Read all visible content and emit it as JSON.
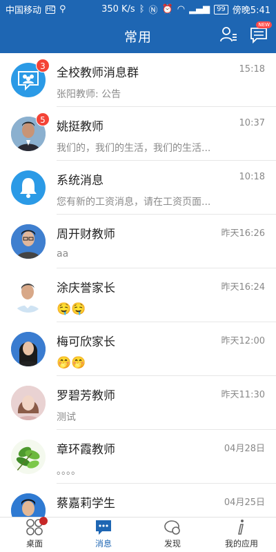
{
  "status_bar": {
    "carrier": "中国移动",
    "hd": "HD",
    "speed": "350 K/s",
    "battery": "99",
    "time": "傍晚5:41"
  },
  "header": {
    "title": "常用",
    "new_badge": "NEW"
  },
  "chats": [
    {
      "name": "全校教师消息群",
      "time": "15:18",
      "preview": "张阳教师: 公告",
      "badge": "3",
      "avatar": "group-icon"
    },
    {
      "name": "姚挺教师",
      "time": "10:37",
      "preview": "我们的，我们的生活，我们的生活...",
      "badge": "5",
      "avatar": "person-photo"
    },
    {
      "name": "系统消息",
      "time": "10:18",
      "preview": "您有新的工资消息，请在工资页面...",
      "badge": "",
      "avatar": "bell-icon"
    },
    {
      "name": "周开财教师",
      "time": "昨天16:26",
      "preview": "aa",
      "badge": "",
      "avatar": "person-photo"
    },
    {
      "name": "涂庆誉家长",
      "time": "昨天16:24",
      "preview": "🤤🤤",
      "badge": "",
      "avatar": "default-avatar"
    },
    {
      "name": "梅可欣家长",
      "time": "昨天12:00",
      "preview": "🤭🤭",
      "badge": "",
      "avatar": "person-photo"
    },
    {
      "name": "罗碧芳教师",
      "time": "昨天11:30",
      "preview": "测试",
      "badge": "",
      "avatar": "person-photo"
    },
    {
      "name": "章环霞教师",
      "time": "04月28日",
      "preview": "。。。。",
      "badge": "",
      "avatar": "plant-photo"
    },
    {
      "name": "蔡嘉莉学生",
      "time": "04月25日",
      "preview": "",
      "badge": "",
      "avatar": "person-photo"
    }
  ],
  "nav": {
    "desktop": "桌面",
    "messages": "消息",
    "discover": "发现",
    "my_apps": "我的应用"
  },
  "colors": {
    "primary": "#1e66b3",
    "badge": "#f44336"
  }
}
